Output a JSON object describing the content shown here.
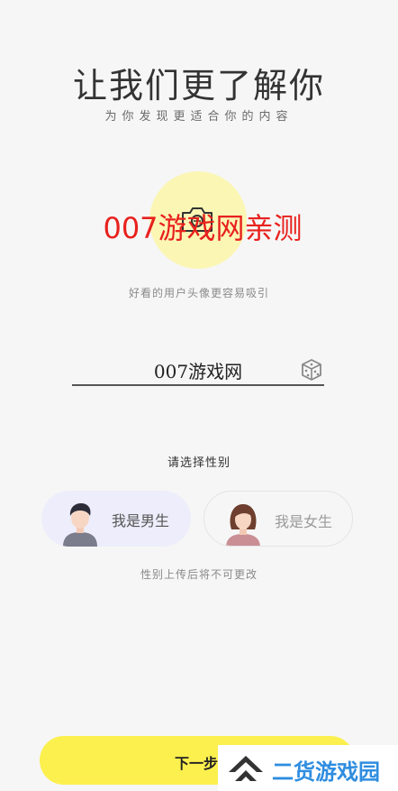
{
  "header": {
    "title": "让我们更了解你",
    "subtitle": "为你发现更适合你的内容"
  },
  "avatar": {
    "icon": "camera-icon",
    "hint": "好看的用户头像更容易吸引",
    "color": "#fbf6b4"
  },
  "watermark": {
    "overlay_text": "007游戏网亲测",
    "brand_text": "二货游戏园"
  },
  "nickname": {
    "value": "007游戏网",
    "random_icon": "dice-icon"
  },
  "gender": {
    "label": "请选择性别",
    "male_label": "我是男生",
    "female_label": "我是女生",
    "note": "性别上传后将不可更改"
  },
  "footer": {
    "next_label": "下一步",
    "accent_color": "#fcf04f"
  }
}
